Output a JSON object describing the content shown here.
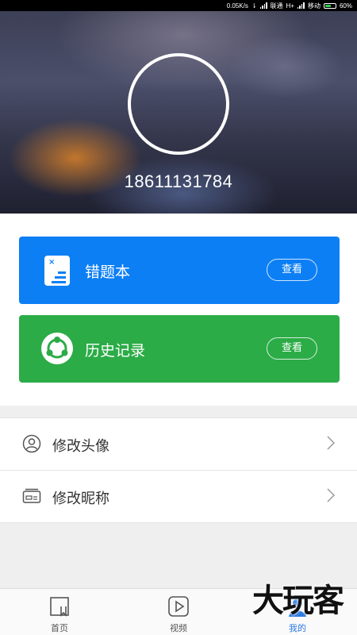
{
  "status_bar": {
    "speed": "0.05K/s",
    "carrier1": "联通",
    "network1": "H+",
    "carrier2": "移动",
    "battery_text": "60%",
    "battery_level": 0.6,
    "battery_color": "#35d04a"
  },
  "profile": {
    "phone": "18611131784"
  },
  "cards": [
    {
      "title": "错题本",
      "button": "查看",
      "color": "#0d7ff5",
      "icon": "wrong-book-icon"
    },
    {
      "title": "历史记录",
      "button": "查看",
      "color": "#2cac47",
      "icon": "history-icon"
    }
  ],
  "settings": [
    {
      "label": "修改头像",
      "icon": "user-avatar-icon"
    },
    {
      "label": "修改昵称",
      "icon": "id-card-icon"
    }
  ],
  "bottom_nav": {
    "tabs": [
      {
        "label": "首页",
        "icon": "home-book-icon"
      },
      {
        "label": "视频",
        "icon": "video-play-icon"
      },
      {
        "label": "我的",
        "icon": "profile-icon",
        "active": true
      }
    ],
    "active_color": "#2a7ae2"
  },
  "watermark": "大玩客"
}
